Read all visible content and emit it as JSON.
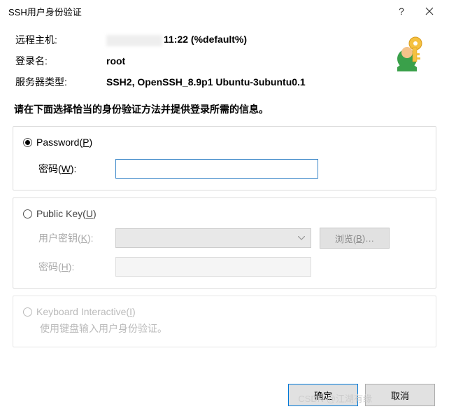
{
  "title": "SSH用户身份验证",
  "info": {
    "host_label": "远程主机:",
    "host_value_suffix": "11:22 (%default%)",
    "login_label": "登录名:",
    "login_value": "root",
    "server_label": "服务器类型:",
    "server_value": "SSH2, OpenSSH_8.9p1 Ubuntu-3ubuntu0.1"
  },
  "instruction": "请在下面选择恰当的身份验证方法并提供登录所需的信息。",
  "auth": {
    "password": {
      "radio_label": "Password(P)",
      "pwd_label": "密码(W):",
      "pwd_value": ""
    },
    "publickey": {
      "radio_label": "Public Key(U)",
      "userkey_label": "用户密钥(K):",
      "pwd_label": "密码(H):",
      "browse_label": "浏览(B)…"
    },
    "keyboard": {
      "radio_label": "Keyboard Interactive(I)",
      "subtext": "使用键盘输入用户身份验证。"
    }
  },
  "buttons": {
    "ok": "确定",
    "cancel": "取消"
  },
  "watermark": "CSDN @江湖有缘"
}
